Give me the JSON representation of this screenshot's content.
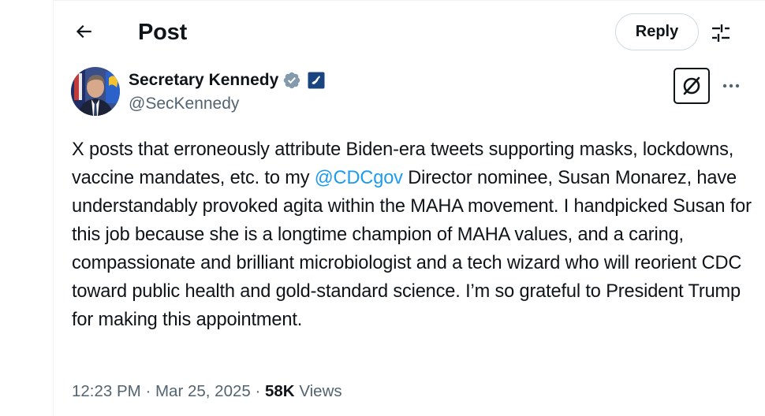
{
  "header": {
    "title": "Post",
    "reply_label": "Reply"
  },
  "author": {
    "name": "Secretary Kennedy",
    "handle": "@SecKennedy",
    "verified_color": "#829aab",
    "affiliate_badge": "hhs-eagle-icon"
  },
  "post": {
    "text_before_mention": "X posts that erroneously attribute Biden-era tweets supporting masks, lockdowns, vaccine mandates, etc. to my ",
    "mention": "@CDCgov",
    "text_after_mention": " Director nominee, Susan Monarez, have understandably provoked agita within the MAHA movement. I handpicked Susan for this job because she is a longtime champion of MAHA values, and a caring, compassionate and brilliant microbiologist and a tech wizard who will reorient CDC toward public health and gold-standard science. I’m so grateful to President Trump for making this appointment."
  },
  "meta": {
    "time": "12:23 PM",
    "separator": " · ",
    "date": "Mar 25, 2025",
    "views_count": "58K",
    "views_label": "Views"
  },
  "colors": {
    "text": "#0f1419",
    "secondary": "#536471",
    "accent": "#1d9bf0",
    "border": "#cfd9de"
  }
}
